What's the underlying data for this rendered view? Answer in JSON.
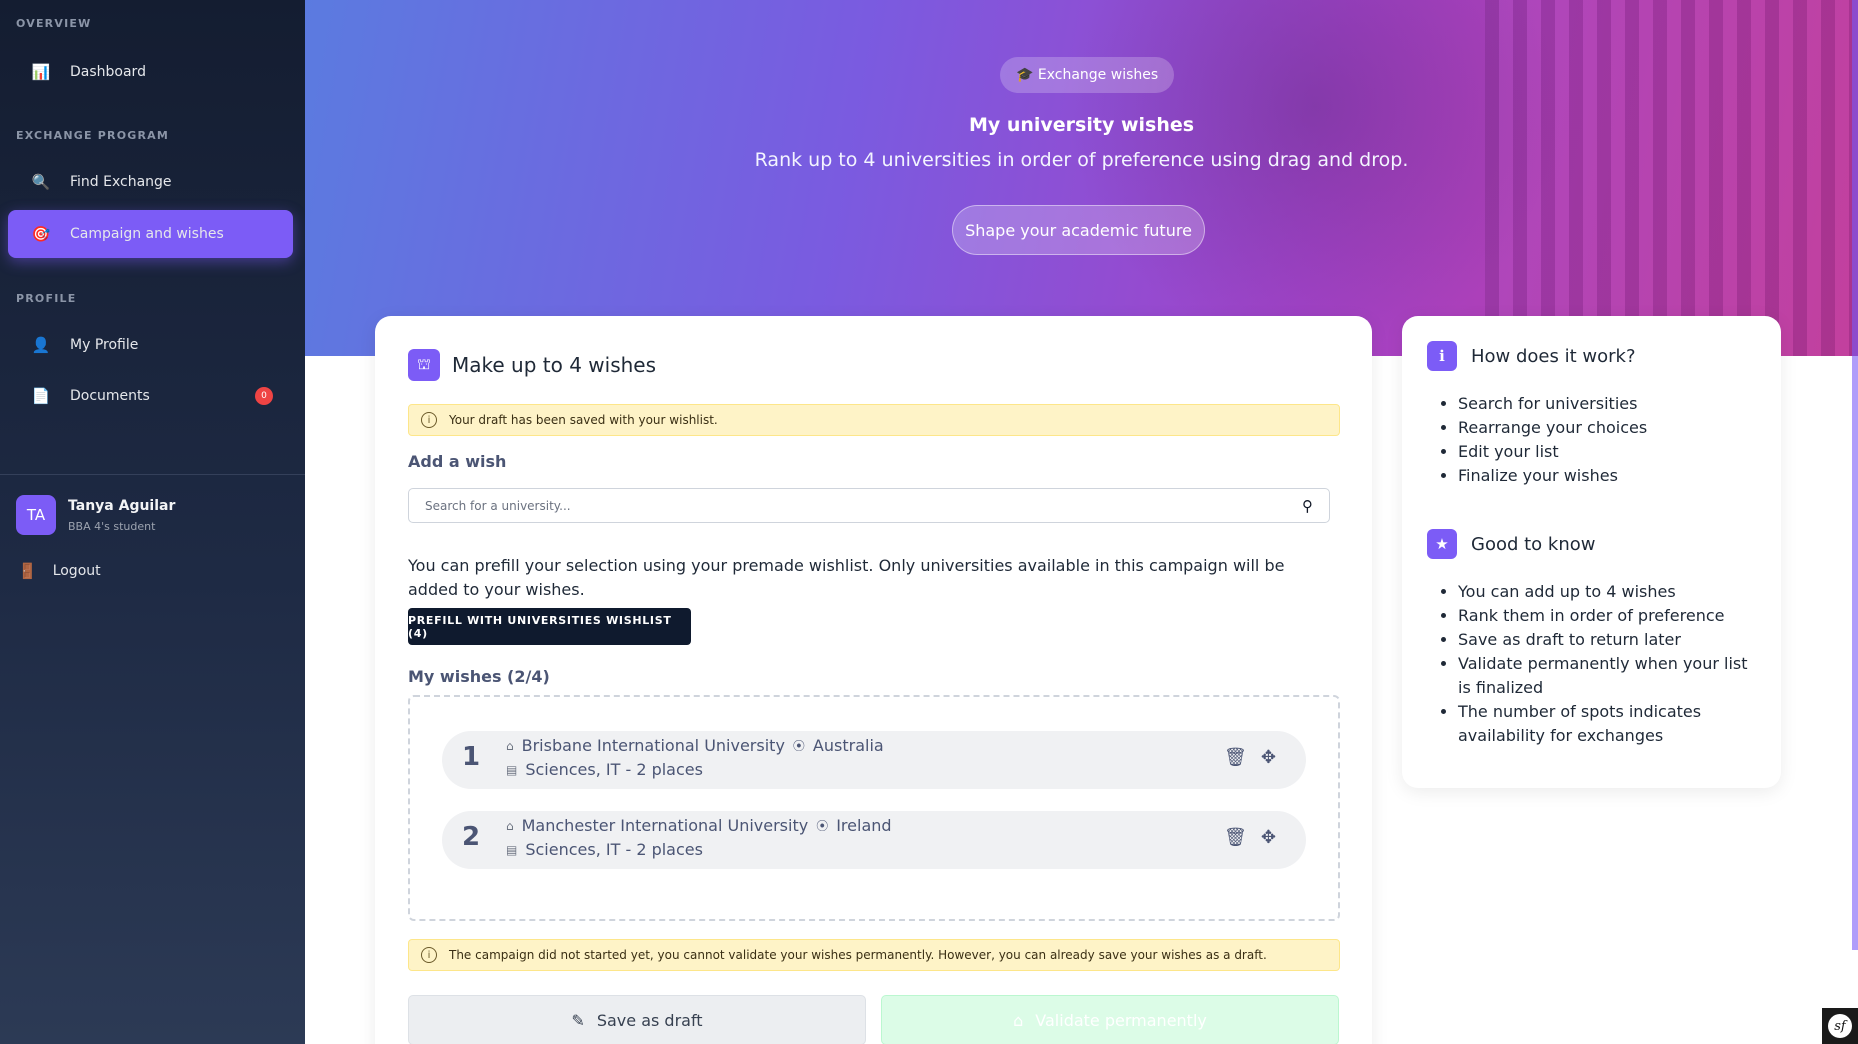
{
  "sidebar": {
    "sections": [
      {
        "title": "OVERVIEW"
      },
      {
        "title": "EXCHANGE PROGRAM"
      },
      {
        "title": "PROFILE"
      }
    ],
    "items": [
      {
        "label": "Dashboard",
        "icon": "bar-chart-icon"
      },
      {
        "label": "Find Exchange",
        "icon": "magnifier-icon"
      },
      {
        "label": "Campaign and wishes",
        "icon": "target-icon",
        "active": true
      },
      {
        "label": "My Profile",
        "icon": "user-icon"
      },
      {
        "label": "Documents",
        "icon": "document-icon",
        "badge": "0"
      }
    ],
    "user": {
      "initials": "TA",
      "name": "Tanya Aguilar",
      "role": "BBA 4's student"
    },
    "logout": "Logout"
  },
  "hero": {
    "pill": "🎓 Exchange wishes",
    "title": "My university wishes",
    "subtitle": "Rank up to 4 universities in order of preference using drag and drop.",
    "button": "Shape your academic future"
  },
  "main": {
    "title": "Make up to 4 wishes",
    "draft_alert": "Your draft has been saved with your wishlist.",
    "add_label": "Add a wish",
    "search_placeholder": "Search for a university...",
    "prefill_text": "You can prefill your selection using your premade wishlist. Only universities available in this campaign will be added to your wishes.",
    "prefill_button": "PREFILL WITH UNIVERSITIES WISHLIST (4)",
    "wishes_label": "My wishes (2/4)",
    "wishes": [
      {
        "rank": "1",
        "university": "Brisbane International University",
        "country": "Australia",
        "details": "Sciences, IT - 2 places"
      },
      {
        "rank": "2",
        "university": "Manchester International University",
        "country": "Ireland",
        "details": "Sciences, IT - 2 places"
      }
    ],
    "campaign_alert": "The campaign did not started yet, you cannot validate your wishes permanently. However, you can already save your wishes as a draft.",
    "save_button": "Save as draft",
    "validate_button": "Validate permanently"
  },
  "side": {
    "how_title": "How does it work?",
    "how_items": [
      "Search for universities",
      "Rearrange your choices",
      "Edit your list",
      "Finalize your wishes"
    ],
    "good_title": "Good to know",
    "good_items": [
      "You can add up to 4 wishes",
      "Rank them in order of preference",
      "Save as draft to return later",
      "Validate permanently when your list is finalized",
      "The number of spots indicates availability for exchanges"
    ]
  },
  "colors": {
    "accent": "#7c5cf6",
    "sidebar_bg": "#141d31",
    "alert_bg": "#fef3c7",
    "prefill_btn": "#0f1a2e"
  }
}
